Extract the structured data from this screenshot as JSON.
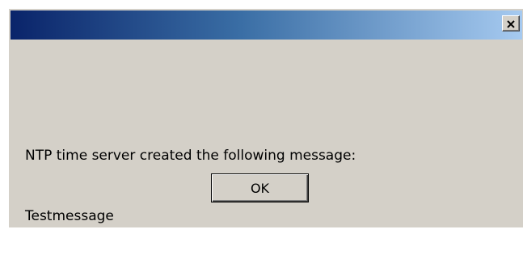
{
  "dialog": {
    "title": "",
    "close_icon": "close-icon",
    "message_line1": "NTP time server created the following message:",
    "message_line2": "Testmessage",
    "ok_label": "OK"
  },
  "colors": {
    "titlebar_start": "#0a246a",
    "titlebar_end": "#a6caf0",
    "dialog_bg": "#d4d0c8"
  }
}
